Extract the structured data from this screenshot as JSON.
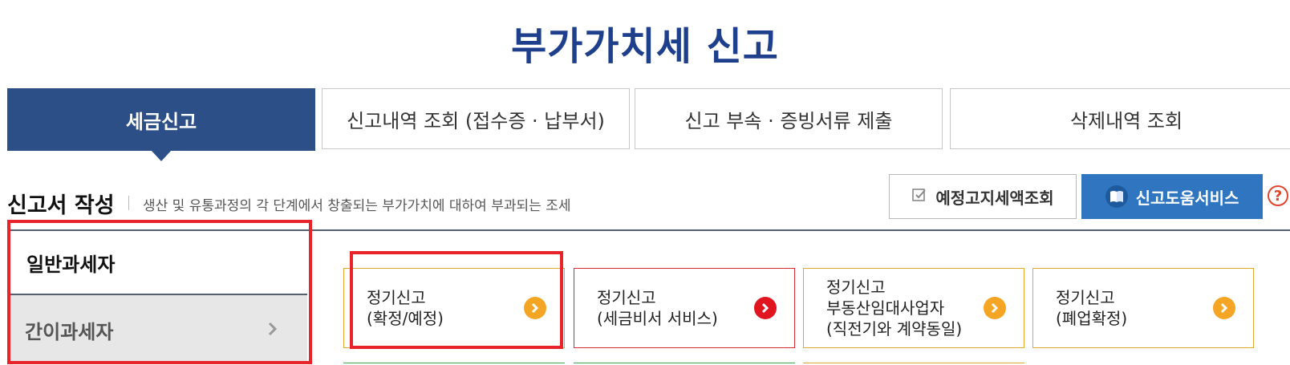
{
  "page": {
    "title": "부가가치세 신고"
  },
  "tabs": [
    {
      "label": "세금신고",
      "active": true
    },
    {
      "label": "신고내역 조회 (접수증 · 납부서)",
      "active": false
    },
    {
      "label": "신고 부속 · 증빙서류 제출",
      "active": false
    },
    {
      "label": "삭제내역 조회",
      "active": false
    }
  ],
  "section": {
    "title": "신고서 작성",
    "description": "생산 및 유통과정의 각 단계에서 창출되는 부가가치에 대하여 부과되는 조세"
  },
  "buttons": {
    "notice_label": "예정고지세액조회",
    "help_label": "신고도움서비스",
    "help_icon": "question-icon"
  },
  "side_tabs": [
    {
      "label": "일반과세자",
      "active": true
    },
    {
      "label": "간이과세자",
      "active": false
    }
  ],
  "cards": [
    {
      "lines": [
        "정기신고",
        "(확정/예정)"
      ],
      "accent": "#f5a524"
    },
    {
      "lines": [
        "정기신고",
        "(세금비서 서비스)"
      ],
      "accent": "#e0151f"
    },
    {
      "lines": [
        "정기신고",
        "부동산임대사업자",
        "(직전기와 계약동일)"
      ],
      "accent": "#f5a524"
    },
    {
      "lines": [
        "정기신고",
        "(폐업확정)"
      ],
      "accent": "#f5a524"
    }
  ],
  "colors": {
    "title": "#1e3f8c",
    "active_tab": "#2b4f86",
    "help_button": "#2f75c0",
    "highlight": "#e8242a"
  }
}
